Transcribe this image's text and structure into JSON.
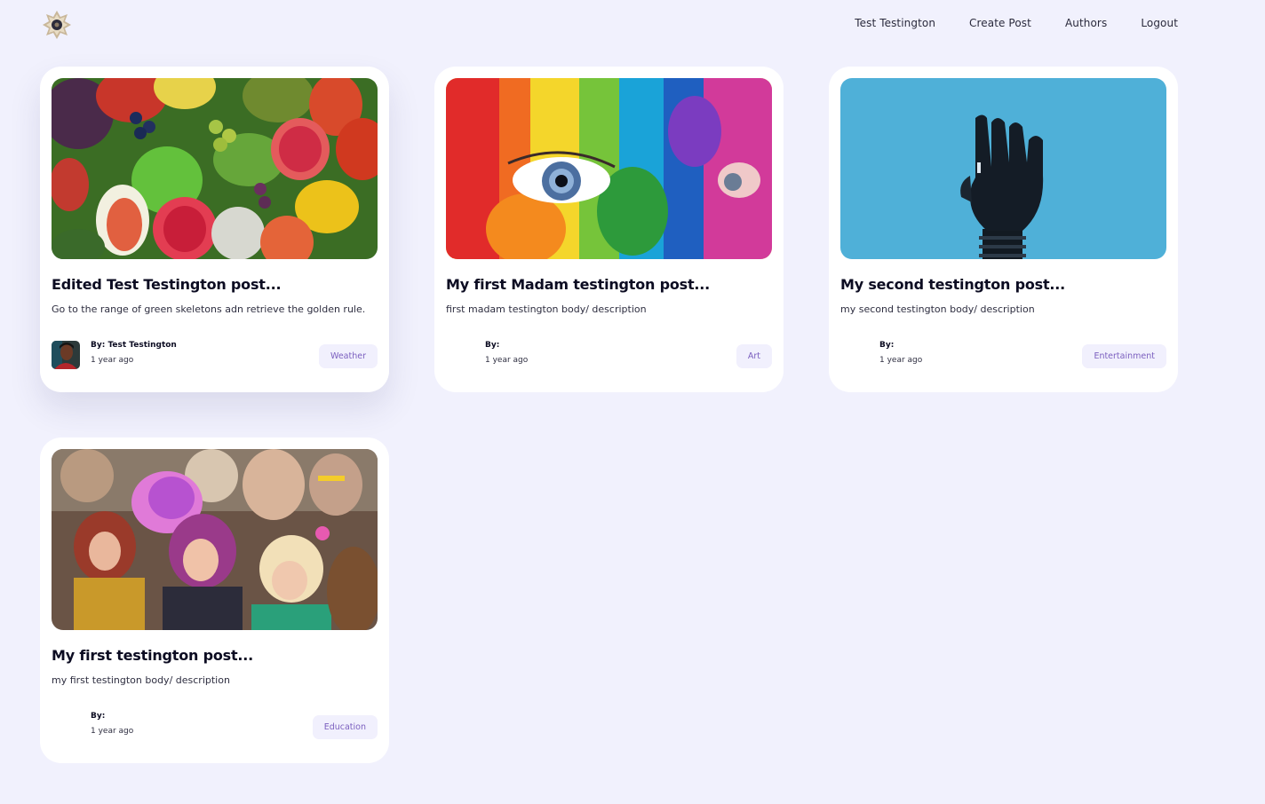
{
  "nav": {
    "logo": "site-logo",
    "links": [
      "Test Testington",
      "Create Post",
      "Authors",
      "Logout"
    ]
  },
  "posts": [
    {
      "image": "fruits-photo",
      "title": "Edited Test Testington post...",
      "description": "Go to the range of green skeletons adn retrieve the golden rule.",
      "by_label": "By:",
      "author": "Test Testington",
      "time": "1 year ago",
      "category": "Weather",
      "has_avatar": true
    },
    {
      "image": "painted-face-photo",
      "title": "My first Madam testington post...",
      "description": "first madam testington body/ description",
      "by_label": "By:",
      "author": "",
      "time": "1 year ago",
      "category": "Art",
      "has_avatar": false
    },
    {
      "image": "robot-hand-photo",
      "title": "My second testington post...",
      "description": "my second testington body/ description",
      "by_label": "By:",
      "author": "",
      "time": "1 year ago",
      "category": "Entertainment",
      "has_avatar": false
    },
    {
      "image": "drag-queens-photo",
      "title": "My first testington post...",
      "description": "my first testington body/ description",
      "by_label": "By:",
      "author": "",
      "time": "1 year ago",
      "category": "Education",
      "has_avatar": false
    }
  ],
  "colors": {
    "page_background": "#f1f1fd",
    "card_background": "#ffffff",
    "tag_background": "#f1f0fd",
    "tag_text": "#7b5fbf"
  }
}
